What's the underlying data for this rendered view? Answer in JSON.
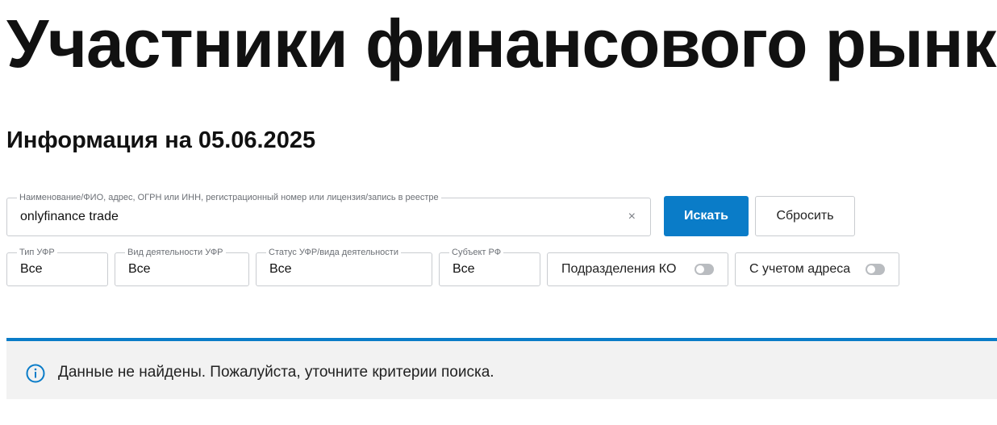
{
  "page": {
    "title": "Участники финансового рынка",
    "info_date": "Информация на 05.06.2025"
  },
  "search": {
    "label": "Наименование/ФИО, адрес, ОГРН или ИНН, регистрационный номер или лицензия/запись в реестре",
    "value": "onlyfinance trade",
    "clear_icon": "×",
    "submit_label": "Искать",
    "reset_label": "Сбросить"
  },
  "filters": {
    "type": {
      "label": "Тип УФР",
      "value": "Все"
    },
    "activity": {
      "label": "Вид деятельности УФР",
      "value": "Все"
    },
    "status": {
      "label": "Статус УФР/вида деятельности",
      "value": "Все"
    },
    "subject": {
      "label": "Субъект РФ",
      "value": "Все"
    }
  },
  "toggles": {
    "ko_divisions": {
      "label": "Подразделения КО",
      "enabled": false
    },
    "with_address": {
      "label": "С учетом адреса",
      "enabled": false
    }
  },
  "result": {
    "icon": "info-icon",
    "message": "Данные не найдены. Пожалуйста, уточните критерии поиска."
  },
  "colors": {
    "accent": "#0a7cc8",
    "panel_bg": "#f2f2f2",
    "border": "#c9ccd0"
  }
}
